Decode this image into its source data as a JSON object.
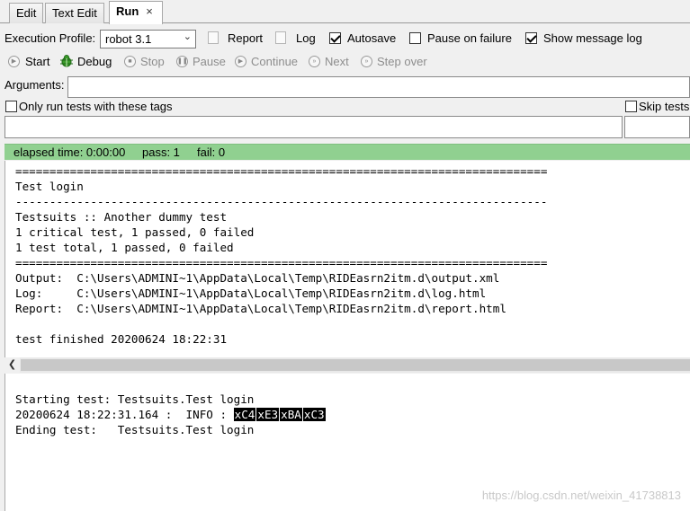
{
  "tabs": [
    {
      "label": "Edit"
    },
    {
      "label": "Text Edit"
    },
    {
      "label": "Run",
      "close": "×"
    }
  ],
  "toolbar": {
    "execution_profile_label": "Execution Profile:",
    "profile_selected": "robot 3.1",
    "report_label": "Report",
    "log_label": "Log",
    "autosave_label": "Autosave",
    "autosave_checked": true,
    "pause_on_failure_label": "Pause on failure",
    "pause_on_failure_checked": false,
    "show_message_log_label": "Show message log",
    "show_message_log_checked": true
  },
  "controls": {
    "start": "Start",
    "debug": "Debug",
    "stop": "Stop",
    "pause": "Pause",
    "continue": "Continue",
    "next": "Next",
    "step_over": "Step over"
  },
  "arguments_label": "Arguments:",
  "only_run_tags_label": "Only run tests with these tags",
  "skip_tests_label": "Skip tests",
  "status": {
    "elapsed": "elapsed time: 0:00:00",
    "pass": "pass: 1",
    "fail": "fail: 0",
    "color": "#90d090"
  },
  "output_lines": [
    "==============================================================================",
    "Test login",
    "------------------------------------------------------------------------------",
    "Testsuits :: Another dummy test",
    "1 critical test, 1 passed, 0 failed",
    "1 test total, 1 passed, 0 failed",
    "==============================================================================",
    "Output:  C:\\Users\\ADMINI~1\\AppData\\Local\\Temp\\RIDEasrn2itm.d\\output.xml",
    "Log:     C:\\Users\\ADMINI~1\\AppData\\Local\\Temp\\RIDEasrn2itm.d\\log.html",
    "Report:  C:\\Users\\ADMINI~1\\AppData\\Local\\Temp\\RIDEasrn2itm.d\\report.html",
    "",
    "test finished 20200624 18:22:31"
  ],
  "message_log": {
    "line1": "Starting test: Testsuits.Test login",
    "line2_prefix": "20200624 18:22:31.164 :  INFO : ",
    "line2_bytes": [
      "xC4",
      "xE3",
      "xBA",
      "xC3"
    ],
    "line3": "Ending test:   Testsuits.Test login"
  },
  "watermark": "https://blog.csdn.net/weixin_41738813"
}
